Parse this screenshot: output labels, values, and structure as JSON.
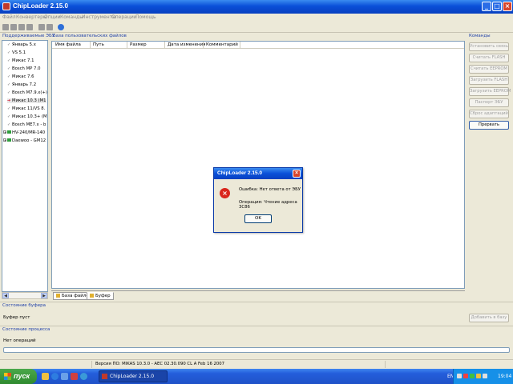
{
  "window": {
    "title": "ChipLoader 2.15.0"
  },
  "menu": [
    "Файл",
    "Конвертеры",
    "Опции",
    "Команды",
    "Инструменты",
    "Операции",
    "Помощь"
  ],
  "left_panel": {
    "title": "Поддерживаемые ЭБУ",
    "items": [
      {
        "label": "Январь 5.x",
        "icon": "check"
      },
      {
        "label": "VS 5.1",
        "icon": "check"
      },
      {
        "label": "Микас 7.1",
        "icon": "check"
      },
      {
        "label": "Bosch MP 7.0",
        "icon": "check"
      },
      {
        "label": "Микас 7.6",
        "icon": "check"
      },
      {
        "label": "Январь 7.2",
        "icon": "check"
      },
      {
        "label": "Bosch M7.9.x(+)",
        "icon": "check"
      },
      {
        "label": "Микас 10.3 (M1",
        "icon": "arrow",
        "selected": true
      },
      {
        "label": "Микас 11/VS 8.",
        "icon": "check"
      },
      {
        "label": "Микас 10.3+ (M",
        "icon": "check"
      },
      {
        "label": "Bosch ME7.x - b",
        "icon": "check"
      },
      {
        "label": "HV-240/MR-140",
        "icon": "folder"
      },
      {
        "label": "Daewoo - GM12",
        "icon": "folder"
      }
    ]
  },
  "center": {
    "title": "База пользовательских файлов",
    "columns": [
      "Имя файла",
      "Путь",
      "Размер",
      "Дата изменения",
      "Комментарий"
    ]
  },
  "tabs": [
    {
      "label": "База файлов",
      "active": true
    },
    {
      "label": "Буфер",
      "active": false
    }
  ],
  "commands": {
    "title": "Команды",
    "buttons": [
      {
        "label": "Установить связь",
        "enabled": false
      },
      {
        "label": "Считать FLASH",
        "enabled": false
      },
      {
        "label": "Считать EEPROM",
        "enabled": false
      },
      {
        "label": "Загрузить FLASH",
        "enabled": false
      },
      {
        "label": "Загрузить EEPROM",
        "enabled": false
      },
      {
        "label": "Паспорт ЭБУ",
        "enabled": false
      },
      {
        "label": "Сброс адаптаций",
        "enabled": false
      },
      {
        "label": "Прервать",
        "enabled": true
      }
    ]
  },
  "buffer_state": {
    "title": "Состояние буфера",
    "text": "Буфер пуст",
    "add_button": "Добавить в базу"
  },
  "process_state": {
    "title": "Состояние процесса",
    "text": "Нет операций",
    "progress": 0
  },
  "statusbar": {
    "version": "Версия ПО: MIKAS 10.3.0 - AEC 02.30.090 CL A Feb 16 2007"
  },
  "dialog": {
    "title": "ChipLoader 2.15.0",
    "message": "Ошибка: Нет ответа от ЭБУ",
    "operation": "Операция: Чтение адреса 3C86",
    "ok": "OK"
  },
  "taskbar": {
    "start": "пуск",
    "task": "ChipLoader 2.15.0",
    "lang": "EN",
    "clock": "19:04"
  }
}
